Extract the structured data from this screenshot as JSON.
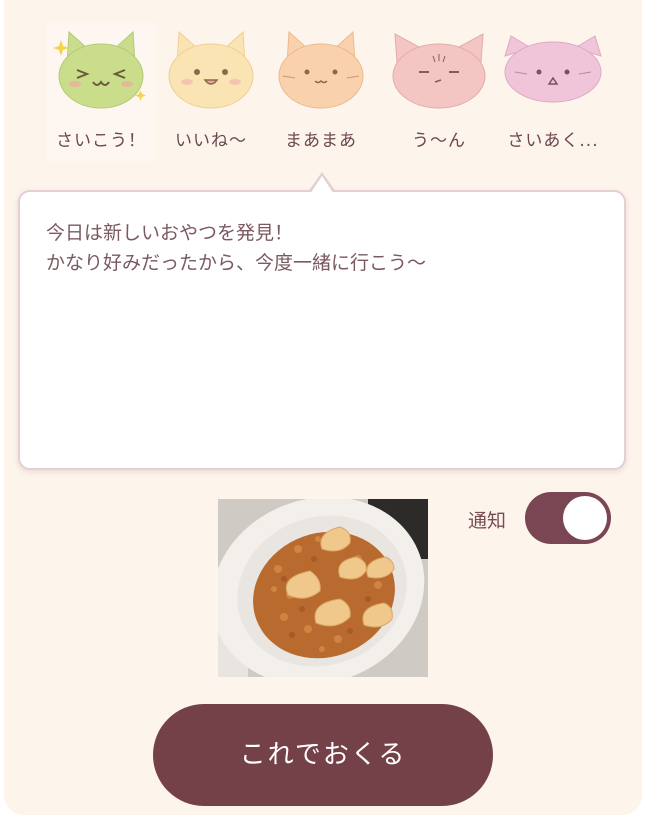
{
  "moods": [
    {
      "label": "さいこう！",
      "icon": "cat-very-happy-icon",
      "color": "#c9dd8b",
      "selected": true
    },
    {
      "label": "いいね〜",
      "icon": "cat-happy-icon",
      "color": "#fbe4b4",
      "selected": false
    },
    {
      "label": "まあまあ",
      "icon": "cat-neutral-icon",
      "color": "#f9d2ad",
      "selected": false
    },
    {
      "label": "う〜ん",
      "icon": "cat-unsure-icon",
      "color": "#f3c6c4",
      "selected": false
    },
    {
      "label": "さいあく...",
      "icon": "cat-worst-icon",
      "color": "#f0c5da",
      "selected": false
    }
  ],
  "message": {
    "text": "今日は新しいおやつを発見！\nかなり好みだったから、今度一緒に行こう〜"
  },
  "photo": {
    "icon": "food-photo"
  },
  "notification": {
    "label": "通知",
    "enabled": true,
    "color": "#7b4654"
  },
  "send_button": {
    "label": "これでおくる",
    "color": "#754149"
  }
}
